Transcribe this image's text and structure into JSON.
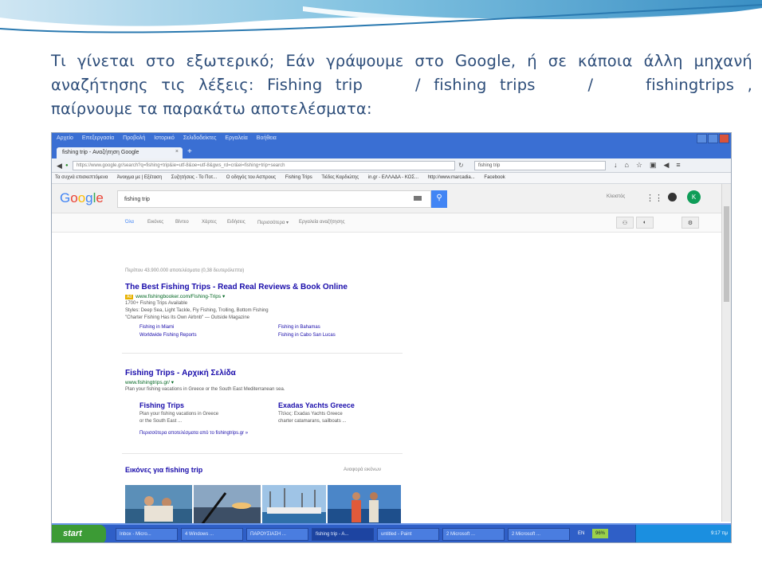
{
  "slide": {
    "line1": "Τι γίνεται στο εξωτερικό; Εάν γράψουμε στο Google, ή σε κάποια άλλη μηχανή",
    "line2": "αναζήτησης τις λέξεις: Fishing trip    / fishing trips    /    fishingtrips ,",
    "line3": "παίρνουμε τα παρακάτω αποτελέσματα:"
  },
  "browser": {
    "menu": [
      "Αρχείο",
      "Επεξεργασία",
      "Προβολή",
      "Ιστορικό",
      "Σελιδοδείκτες",
      "Εργαλεία",
      "Βοήθεια"
    ],
    "tab_title": "fishing trip - Αναζήτηση Google",
    "tab_close": "×",
    "new_tab": "+",
    "url": "https://www.google.gr/search?q=fishing+trip&ie=utf-8&oe=utf-8&gws_rd=cr&ei=fishing+trip+search",
    "search_value": "fishing trip",
    "bookmarks": [
      "Τα συχνά επισκεπτόμενα",
      "Άνοιγμα με | Εξέταση",
      "Συζητήσεις - Το Ποτ...",
      "Ο οδηγός του Ασπρους",
      "Fishing Trips",
      "Τιέδες Καρδιώτης",
      "in.gr - ΕΛΛΑΔΑ - ΚΟΣ...",
      "http://www.marcadia...",
      "Facebook"
    ]
  },
  "google": {
    "query": "fishing trip",
    "signin": "Κλειστός",
    "avatar_letter": "K",
    "tabs": [
      "Όλα",
      "Εικόνες",
      "Βίντεο",
      "Χάρτες",
      "Ειδήσεις",
      "Περισσότερα ▾",
      "Εργαλεία αναζήτησης"
    ],
    "stats": "Περίπου 43.900.000 αποτελέσματα (0,38 δευτερόλεπτα)",
    "result1": {
      "title": "The Best Fishing Trips - Read Real Reviews & Book Online",
      "ad": "Ad",
      "url": "www.fishingbooker.com/Fishing-Trips ▾",
      "snip1": "1700+ Fishing Trips Available",
      "snip2": "Styles: Deep Sea, Light Tackle, Fly Fishing, Trolling, Bottom Fishing",
      "snip3": "\"Charter Fishing Has Its Own Airbnb\" — Outside Magazine",
      "links": [
        "Fishing in Miami",
        "Fishing in Bahamas",
        "Worldwide Fishing Reports",
        "Fishing in Cabo San Lucas"
      ]
    },
    "result2": {
      "title": "Fishing Trips - Αρχική Σελίδα",
      "url": "www.fishingtrips.gr/ ▾",
      "snip": "Plan your fishing vacations in Greece or the South East Mediterranean sea.",
      "sub1_title": "Fishing Trips",
      "sub1_snip1": "Plan your fishing vacations in Greece",
      "sub1_snip2": "or the South East ...",
      "sub2_title": "Exadas Yachts Greece",
      "sub2_snip1": "Τίτλος: Exadas Yachts Greece",
      "sub2_snip2": "charter catamarans, sailboats ...",
      "more": "Περισσότερα αποτελέσματα από το fishingtrips.gr »"
    },
    "images": {
      "title": "Εικόνες για fishing trip",
      "more": "Αναφορά εικόνων"
    }
  },
  "taskbar": {
    "start": "start",
    "tasks": [
      "Inbox - Micro...",
      "4 Windows ...",
      "ΠΑΡΟΥΣΙΑΣΗ ...",
      "fishing trip - A...",
      "untitled - Paint",
      "2 Microsoft ...",
      "2 Microsoft ..."
    ],
    "lang": "EN",
    "battery": "96%",
    "time": "9:17 πμ"
  }
}
